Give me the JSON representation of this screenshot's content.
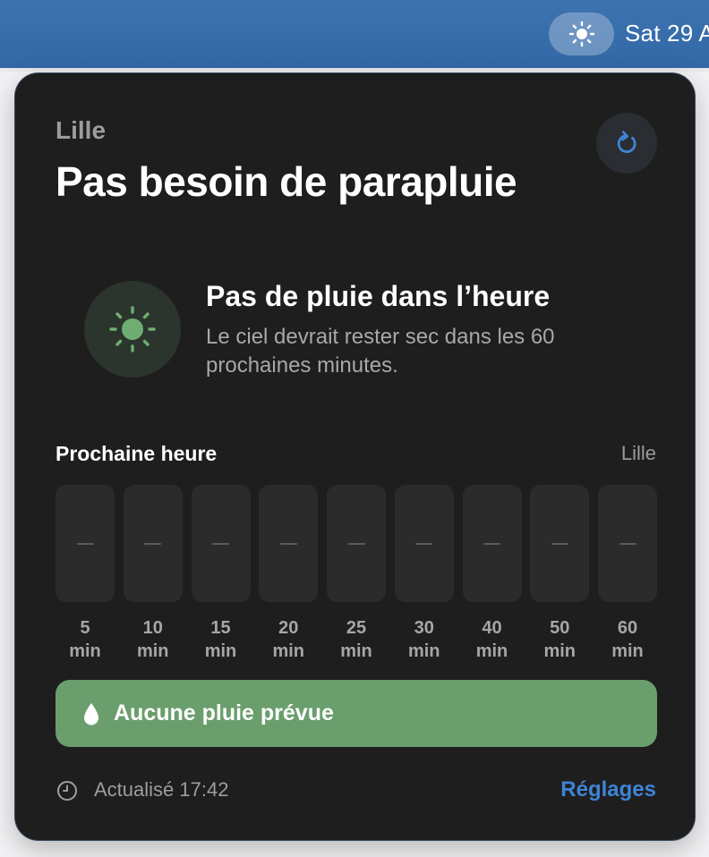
{
  "menubar": {
    "weather_icon": "sun-icon",
    "date_text": "Sat 29 A"
  },
  "panel": {
    "city": "Lille",
    "title": "Pas besoin de parapluie",
    "refresh_icon": "refresh-icon",
    "summary": {
      "icon": "sun-icon",
      "title": "Pas de pluie dans l’heure",
      "text": "Le ciel devrait rester sec dans les 60 prochaines minutes."
    },
    "forecast": {
      "label": "Prochaine heure",
      "city": "Lille",
      "slots": [
        {
          "value": "–",
          "minutes": "5",
          "unit": "min"
        },
        {
          "value": "–",
          "minutes": "10",
          "unit": "min"
        },
        {
          "value": "–",
          "minutes": "15",
          "unit": "min"
        },
        {
          "value": "–",
          "minutes": "20",
          "unit": "min"
        },
        {
          "value": "–",
          "minutes": "25",
          "unit": "min"
        },
        {
          "value": "–",
          "minutes": "30",
          "unit": "min"
        },
        {
          "value": "–",
          "minutes": "40",
          "unit": "min"
        },
        {
          "value": "–",
          "minutes": "50",
          "unit": "min"
        },
        {
          "value": "–",
          "minutes": "60",
          "unit": "min"
        }
      ]
    },
    "banner": {
      "icon": "raindrop-icon",
      "text": "Aucune pluie prévue",
      "color": "#6a9e6d"
    },
    "footer": {
      "clock_icon": "clock-icon",
      "updated": "Actualisé 17:42",
      "settings": "Réglages"
    }
  },
  "colors": {
    "accent": "#3f84d4",
    "panel_bg": "#1e1e1e",
    "menubar_bg": "#3d73b0",
    "sun": "#6fae72"
  }
}
